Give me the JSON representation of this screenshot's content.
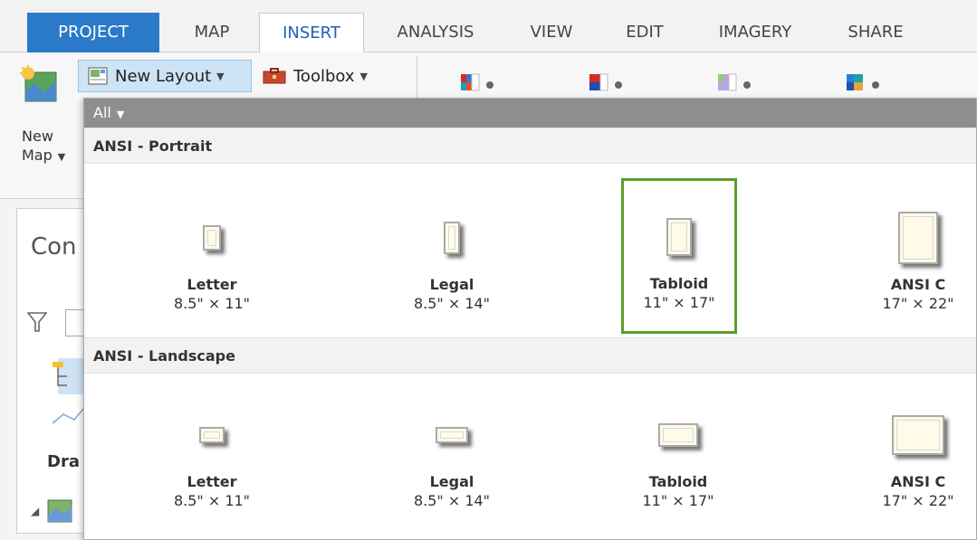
{
  "tabs": [
    {
      "label": "PROJECT"
    },
    {
      "label": "MAP"
    },
    {
      "label": "INSERT"
    },
    {
      "label": "ANALYSIS"
    },
    {
      "label": "VIEW"
    },
    {
      "label": "EDIT"
    },
    {
      "label": "IMAGERY"
    },
    {
      "label": "SHARE"
    }
  ],
  "active_tab": "INSERT",
  "ribbon": {
    "new_map_label_1": "New",
    "new_map_label_2": "Map",
    "new_layout_label": "New Layout",
    "toolbox_label": "Toolbox"
  },
  "left_dock": {
    "contents_partial": "Con",
    "drawing_partial": "Dra"
  },
  "dropdown": {
    "filter_label": "All",
    "sections": [
      {
        "title": "ANSI - Portrait",
        "items": [
          {
            "name": "Letter",
            "size": "8.5\" × 11\""
          },
          {
            "name": "Legal",
            "size": "8.5\" × 14\""
          },
          {
            "name": "Tabloid",
            "size": "11\" × 17\""
          },
          {
            "name": "ANSI C",
            "size": "17\" × 22\""
          }
        ]
      },
      {
        "title": "ANSI - Landscape",
        "items": [
          {
            "name": "Letter",
            "size": "8.5\" × 11\""
          },
          {
            "name": "Legal",
            "size": "8.5\" × 14\""
          },
          {
            "name": "Tabloid",
            "size": "11\" × 17\""
          },
          {
            "name": "ANSI C",
            "size": "17\" × 22\""
          }
        ]
      }
    ],
    "selected_item": "Tabloid"
  },
  "colors": {
    "accent": "#2b79c9",
    "selection": "#5a9e2a",
    "filter_bar": "#8e8e8e"
  }
}
